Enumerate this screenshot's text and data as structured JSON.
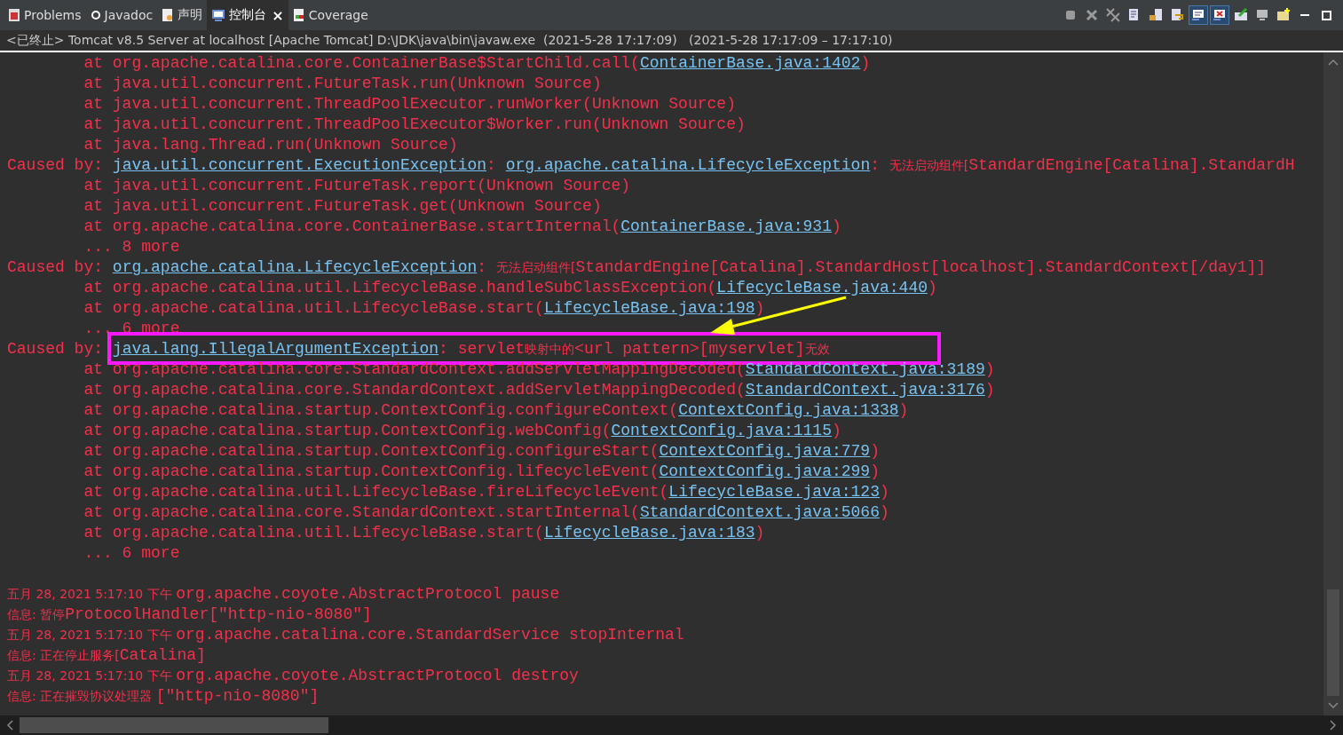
{
  "tabs": [
    {
      "label": "Problems",
      "kind": "problems",
      "selected": false
    },
    {
      "label": "Javadoc",
      "kind": "javadoc",
      "selected": false
    },
    {
      "label": "声明",
      "kind": "declaration",
      "selected": false
    },
    {
      "label": "控制台",
      "kind": "console",
      "selected": true,
      "close_glyph": "×"
    },
    {
      "label": "Coverage",
      "kind": "coverage",
      "selected": false
    }
  ],
  "toolbar": [
    {
      "kind": "stop",
      "on": false
    },
    {
      "kind": "remove",
      "on": false
    },
    {
      "kind": "remove-all",
      "on": false
    },
    {
      "kind": "clear",
      "on": false
    },
    {
      "kind": "scroll-lock",
      "on": false
    },
    {
      "kind": "word-wrap",
      "on": false
    },
    {
      "kind": "show-out",
      "on": true
    },
    {
      "kind": "show-err",
      "on": true
    },
    {
      "kind": "pin",
      "on": false
    },
    {
      "kind": "display",
      "on": false
    },
    {
      "kind": "new-console",
      "on": false
    },
    {
      "kind": "minimize",
      "on": false
    },
    {
      "kind": "maximize",
      "on": false
    }
  ],
  "process_title": "<已终止> Tomcat v8.5 Server at localhost [Apache Tomcat] D:\\JDK\\java\\bin\\javaw.exe  (2021-5-28 17:17:09)   (2021-5-28 17:17:09 – 17:17:10)",
  "console_lines": [
    {
      "highlighted": false,
      "segments": [
        {
          "kind": "plain",
          "text": "        at org.apache.catalina.core.ContainerBase$StartChild.call("
        },
        {
          "kind": "link",
          "text": "ContainerBase.java:1402"
        },
        {
          "kind": "plain",
          "text": ")"
        }
      ]
    },
    {
      "highlighted": false,
      "segments": [
        {
          "kind": "plain",
          "text": "        at java.util.concurrent.FutureTask.run(Unknown Source)"
        }
      ]
    },
    {
      "highlighted": false,
      "segments": [
        {
          "kind": "plain",
          "text": "        at java.util.concurrent.ThreadPoolExecutor.runWorker(Unknown Source)"
        }
      ]
    },
    {
      "highlighted": false,
      "segments": [
        {
          "kind": "plain",
          "text": "        at java.util.concurrent.ThreadPoolExecutor$Worker.run(Unknown Source)"
        }
      ]
    },
    {
      "highlighted": false,
      "segments": [
        {
          "kind": "plain",
          "text": "        at java.lang.Thread.run(Unknown Source)"
        }
      ]
    },
    {
      "highlighted": false,
      "segments": [
        {
          "kind": "plain",
          "text": "Caused by: "
        },
        {
          "kind": "link",
          "text": "java.util.concurrent.ExecutionException"
        },
        {
          "kind": "plain",
          "text": ": "
        },
        {
          "kind": "link",
          "text": "org.apache.catalina.LifecycleException"
        },
        {
          "kind": "plain",
          "text": ": "
        },
        {
          "kind": "cjk",
          "text": "无法启动组件["
        },
        {
          "kind": "plain",
          "text": "StandardEngine[Catalina].StandardH"
        }
      ]
    },
    {
      "highlighted": false,
      "segments": [
        {
          "kind": "plain",
          "text": "        at java.util.concurrent.FutureTask.report(Unknown Source)"
        }
      ]
    },
    {
      "highlighted": false,
      "segments": [
        {
          "kind": "plain",
          "text": "        at java.util.concurrent.FutureTask.get(Unknown Source)"
        }
      ]
    },
    {
      "highlighted": false,
      "segments": [
        {
          "kind": "plain",
          "text": "        at org.apache.catalina.core.ContainerBase.startInternal("
        },
        {
          "kind": "link",
          "text": "ContainerBase.java:931"
        },
        {
          "kind": "plain",
          "text": ")"
        }
      ]
    },
    {
      "highlighted": false,
      "segments": [
        {
          "kind": "plain",
          "text": "        ... 8 more"
        }
      ]
    },
    {
      "highlighted": false,
      "segments": [
        {
          "kind": "plain",
          "text": "Caused by: "
        },
        {
          "kind": "link",
          "text": "org.apache.catalina.LifecycleException"
        },
        {
          "kind": "plain",
          "text": ": "
        },
        {
          "kind": "cjk",
          "text": "无法启动组件["
        },
        {
          "kind": "plain",
          "text": "StandardEngine[Catalina].StandardHost[localhost].StandardContext[/day1]]"
        }
      ]
    },
    {
      "highlighted": false,
      "segments": [
        {
          "kind": "plain",
          "text": "        at org.apache.catalina.util.LifecycleBase.handleSubClassException("
        },
        {
          "kind": "link",
          "text": "LifecycleBase.java:440"
        },
        {
          "kind": "plain",
          "text": ")"
        }
      ]
    },
    {
      "highlighted": false,
      "segments": [
        {
          "kind": "plain",
          "text": "        at org.apache.catalina.util.LifecycleBase.start("
        },
        {
          "kind": "link",
          "text": "LifecycleBase.java:198"
        },
        {
          "kind": "plain",
          "text": ")"
        }
      ]
    },
    {
      "highlighted": false,
      "segments": [
        {
          "kind": "plain",
          "text": "        ... 6 more"
        }
      ]
    },
    {
      "highlighted": true,
      "segments": [
        {
          "kind": "plain",
          "text": "Caused by: "
        },
        {
          "kind": "link",
          "text": "java.lang.IllegalArgumentException"
        },
        {
          "kind": "plain",
          "text": ": servlet"
        },
        {
          "kind": "cjk",
          "text": "映射中的"
        },
        {
          "kind": "plain",
          "text": "<url pattern>[myservlet]"
        },
        {
          "kind": "cjk",
          "text": "无效"
        }
      ]
    },
    {
      "highlighted": false,
      "segments": [
        {
          "kind": "plain",
          "text": "        at org.apache.catalina.core.StandardContext.addServletMappingDecoded("
        },
        {
          "kind": "link",
          "text": "StandardContext.java:3189"
        },
        {
          "kind": "plain",
          "text": ")"
        }
      ]
    },
    {
      "highlighted": false,
      "segments": [
        {
          "kind": "plain",
          "text": "        at org.apache.catalina.core.StandardContext.addServletMappingDecoded("
        },
        {
          "kind": "link",
          "text": "StandardContext.java:3176"
        },
        {
          "kind": "plain",
          "text": ")"
        }
      ]
    },
    {
      "highlighted": false,
      "segments": [
        {
          "kind": "plain",
          "text": "        at org.apache.catalina.startup.ContextConfig.configureContext("
        },
        {
          "kind": "link",
          "text": "ContextConfig.java:1338"
        },
        {
          "kind": "plain",
          "text": ")"
        }
      ]
    },
    {
      "highlighted": false,
      "segments": [
        {
          "kind": "plain",
          "text": "        at org.apache.catalina.startup.ContextConfig.webConfig("
        },
        {
          "kind": "link",
          "text": "ContextConfig.java:1115"
        },
        {
          "kind": "plain",
          "text": ")"
        }
      ]
    },
    {
      "highlighted": false,
      "segments": [
        {
          "kind": "plain",
          "text": "        at org.apache.catalina.startup.ContextConfig.configureStart("
        },
        {
          "kind": "link",
          "text": "ContextConfig.java:779"
        },
        {
          "kind": "plain",
          "text": ")"
        }
      ]
    },
    {
      "highlighted": false,
      "segments": [
        {
          "kind": "plain",
          "text": "        at org.apache.catalina.startup.ContextConfig.lifecycleEvent("
        },
        {
          "kind": "link",
          "text": "ContextConfig.java:299"
        },
        {
          "kind": "plain",
          "text": ")"
        }
      ]
    },
    {
      "highlighted": false,
      "segments": [
        {
          "kind": "plain",
          "text": "        at org.apache.catalina.util.LifecycleBase.fireLifecycleEvent("
        },
        {
          "kind": "link",
          "text": "LifecycleBase.java:123"
        },
        {
          "kind": "plain",
          "text": ")"
        }
      ]
    },
    {
      "highlighted": false,
      "segments": [
        {
          "kind": "plain",
          "text": "        at org.apache.catalina.core.StandardContext.startInternal("
        },
        {
          "kind": "link",
          "text": "StandardContext.java:5066"
        },
        {
          "kind": "plain",
          "text": ")"
        }
      ]
    },
    {
      "highlighted": false,
      "segments": [
        {
          "kind": "plain",
          "text": "        at org.apache.catalina.util.LifecycleBase.start("
        },
        {
          "kind": "link",
          "text": "LifecycleBase.java:183"
        },
        {
          "kind": "plain",
          "text": ")"
        }
      ]
    },
    {
      "highlighted": false,
      "segments": [
        {
          "kind": "plain",
          "text": "        ... 6 more"
        }
      ]
    }
  ],
  "log_lines": [
    [
      {
        "kind": "cjk",
        "text": "五月 28, 2021 5:17:10 下午 "
      },
      {
        "kind": "plain",
        "text": "org.apache.coyote.AbstractProtocol pause"
      }
    ],
    [
      {
        "kind": "cjk",
        "text": "信息: 暂停"
      },
      {
        "kind": "plain",
        "text": "ProtocolHandler[\"http-nio-8080\"]"
      }
    ],
    [
      {
        "kind": "cjk",
        "text": "五月 28, 2021 5:17:10 下午 "
      },
      {
        "kind": "plain",
        "text": "org.apache.catalina.core.StandardService stopInternal"
      }
    ],
    [
      {
        "kind": "cjk",
        "text": "信息: 正在停止服务["
      },
      {
        "kind": "plain",
        "text": "Catalina]"
      }
    ],
    [
      {
        "kind": "cjk",
        "text": "五月 28, 2021 5:17:10 下午 "
      },
      {
        "kind": "plain",
        "text": "org.apache.coyote.AbstractProtocol destroy"
      }
    ],
    [
      {
        "kind": "cjk",
        "text": "信息: 正在摧毁协议处理器 "
      },
      {
        "kind": "plain",
        "text": "[\"http-nio-8080\"]"
      }
    ]
  ]
}
